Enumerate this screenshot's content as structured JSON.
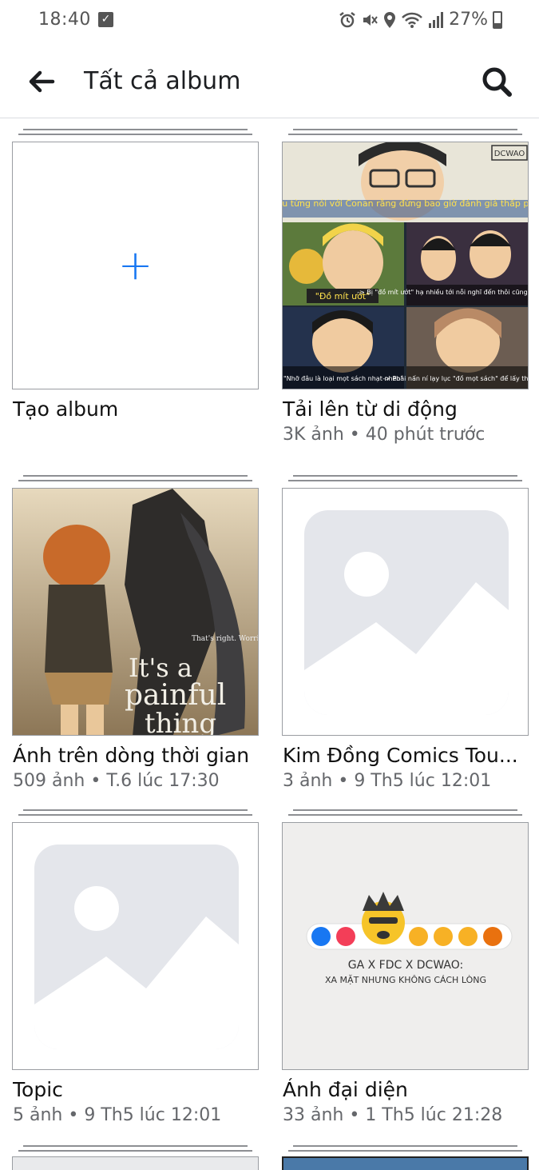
{
  "status_bar": {
    "time": "18:40",
    "battery": "27%"
  },
  "header": {
    "title": "Tất cả album"
  },
  "albums": [
    {
      "name": "Tạo album",
      "meta": ""
    },
    {
      "name": "Tải lên từ di động",
      "meta": "3K ảnh • 40 phút trước"
    },
    {
      "name": "Ảnh trên dòng thời gian",
      "meta": "509 ảnh • T.6 lúc 17:30"
    },
    {
      "name": "Kim Đồng Comics Tou...",
      "meta": "3 ảnh • 9 Th5 lúc 12:01"
    },
    {
      "name": "Topic",
      "meta": "5 ảnh • 9 Th5 lúc 12:01"
    },
    {
      "name": "Ảnh đại diện",
      "meta": "33 ảnh • 1 Th5 lúc 21:28"
    }
  ],
  "covers": {
    "mobile_upload": {
      "logo": "DCWAO",
      "caption_top": "Yusaku từng nói với Conan rằng đừng bao giờ đánh giá thấp phụ nữ",
      "caption_mid_left": "\"Đồ mít ướt\"",
      "caption_mid_right": "-> Bị \"đồ mít ướt\" hạ nhiều tới nỗi nghĩ đến thôi cũng toát mồ hôi hột",
      "caption_bottom_left": "\"Nhỡ đâu là loại mọt sách nhạt nhẽo\"",
      "caption_bottom_right": "-> Phải nấn ní lạy lục \"đồ mọt sách\" để lấy thuốc giải"
    },
    "timeline": {
      "quote_small": "That's right. Worried about being discovered, living in fear.",
      "quote_line1": "It's a",
      "quote_line2": "painful",
      "quote_line3": "thing"
    },
    "profile": {
      "line1": "GA X FDC X DCWAO:",
      "line2": "XA MẶT NHƯNG KHÔNG CÁCH LÒNG"
    }
  },
  "colors": {
    "accent": "#1877f2",
    "placeholder": "#e4e6eb",
    "meta_text": "#65676b"
  }
}
